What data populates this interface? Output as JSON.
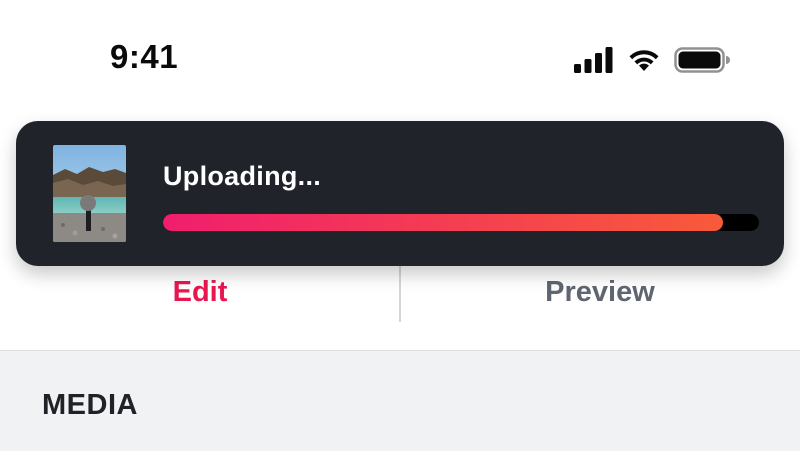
{
  "status_bar": {
    "time": "9:41",
    "icons": [
      "cellular-signal-icon",
      "wifi-icon",
      "battery-icon"
    ]
  },
  "upload": {
    "label": "Uploading...",
    "progress": 0.94,
    "thumbnail": "uploaded-photo-thumbnail",
    "colors": {
      "card": "#20232a",
      "progress_start": "#f01e6e",
      "progress_end": "#f85a3a",
      "track": "#000000"
    }
  },
  "tabs": {
    "edit": "Edit",
    "preview": "Preview",
    "active": "edit",
    "colors": {
      "active": "#e8174f",
      "inactive": "#5f6670"
    }
  },
  "media": {
    "title": "MEDIA"
  }
}
